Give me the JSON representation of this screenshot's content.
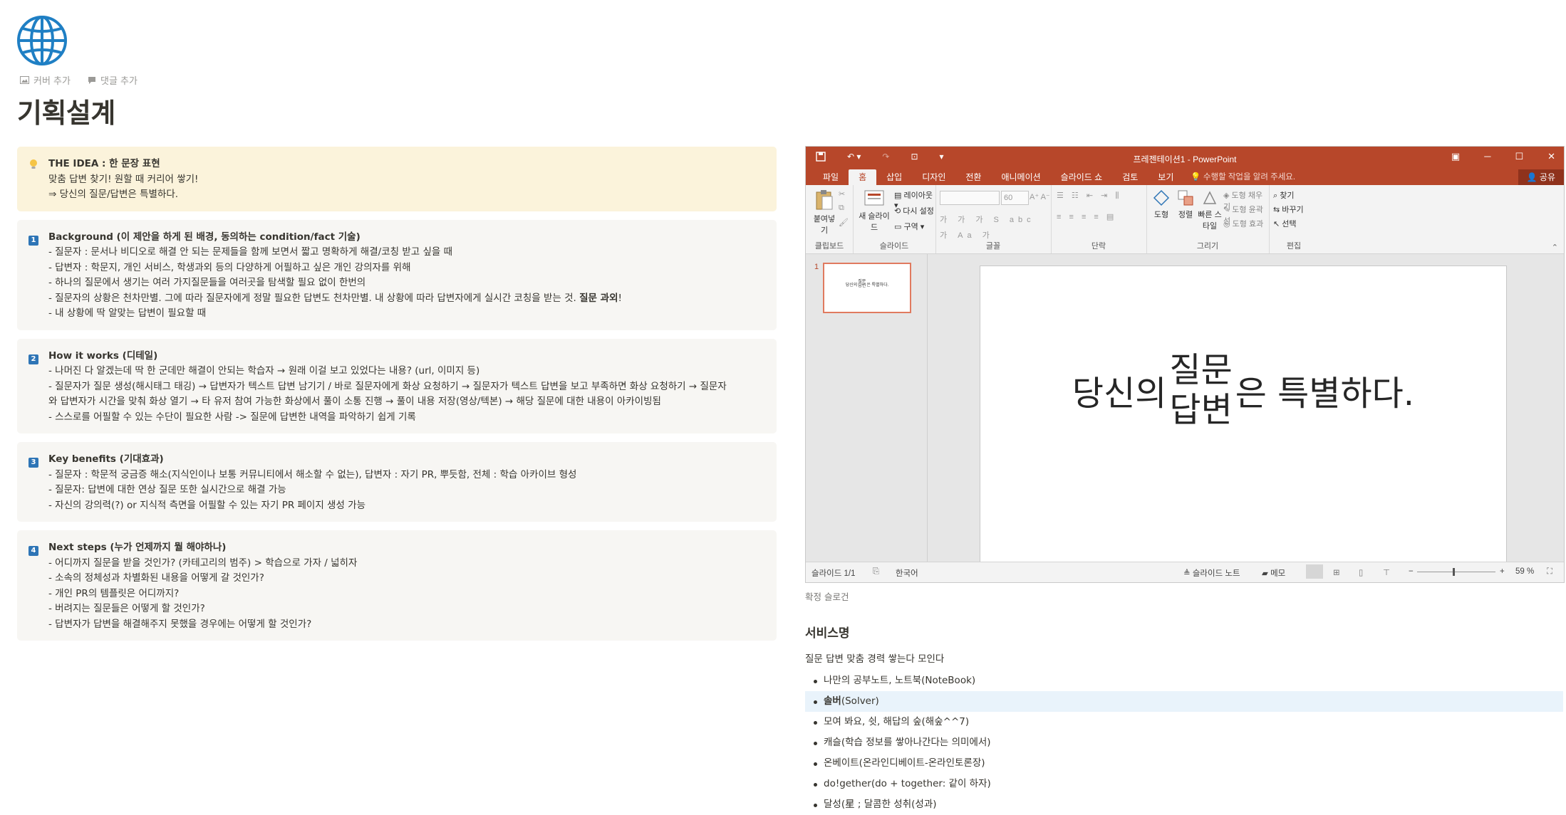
{
  "page": {
    "title": "기획설계",
    "actions": {
      "cover": "커버 추가",
      "comment": "댓글 추가"
    }
  },
  "callouts": {
    "idea": {
      "title": "THE IDEA : 한 문장 표현",
      "lines": [
        "맞춤 답변 찾기! 원할 때 커리어 쌓기!",
        "⇒ 당신의 질문/답변은 특별하다."
      ]
    },
    "background": {
      "num": "1",
      "title_a": "Background (",
      "title_b": "이 제안을 하게 된 배경, 동의하는 condition/fact 기술",
      "title_c": ")",
      "lines": [
        "- 질문자 : 문서나 비디오로 해결 안 되는 문제들을 함께 보면서 짧고 명확하게 해결/코칭  받고 싶을 때",
        "- 답변자 : 학문지, 개인 서비스, 학생과외 등의 다양하게 어필하고 싶은 개인 강의자를 위해",
        "- 하나의 질문에서 생기는 여러 가지질문들을 여러곳을 탐색할 필요 없이 한번의",
        "- 질문자의 상황은 천차만별. 그에 따라 질문자에게 정말 필요한 답변도 천차만별. 내 상황에 따라 답변자에게 실시간 코칭을 받는 것.",
        "- 내 상황에 딱 알맞는 답변이 필요할 때"
      ],
      "emph": "질문 과외",
      "emph_tail": "!"
    },
    "how": {
      "num": "2",
      "title_a": "How it works (",
      "title_b": "디테일",
      "title_c": ")",
      "lines": [
        "- 나머진 다 알겠는데 딱 한 군데만 해결이 안되는 학습자 → 원래 이걸 보고 있었다는 내용? (url, 이미지 등)",
        "- 질문자가 질문 생성(해시태그 태깅) → 답변자가 텍스트 답변 남기기 / 바로 질문자에게 화상 요청하기 → 질문자가 텍스트 답변을 보고 부족하면 화상 요청하기 → 질문자",
        "와 답변자가 시간을 맞춰 화상 열기 → 타 유저 참여 가능한 화상에서 풀이 소통 진행 → 풀이 내용 저장(영상/텍본) → 해당 질문에 대한 내용이 아카이빙됨",
        "- 스스로를 어필할 수 있는 수단이 필요한 사람 -> 질문에 답변한 내역을 파악하기 쉽게 기록"
      ]
    },
    "benefits": {
      "num": "3",
      "title_a": "Key benefits (",
      "title_b": "기대효과",
      "title_c": ")",
      "lines": [
        "- 질문자 : 학문적 궁금증 해소(지식인이나 보통 커뮤니티에서 해소할 수 없는), 답변자 : 자기 PR, 뿌듯함, 전체 : 학습 아카이브 형성",
        "- 질문자: 답변에 대한 연상 질문 또한 실시간으로 해결 가능",
        "- 자신의 강의력(?) or 지식적 측면을 어필할 수 있는 자기 PR 페이지 생성 가능"
      ]
    },
    "next": {
      "num": "4",
      "title_a": "Next steps (",
      "title_b": "누가 언제까지 뭘 해야하나",
      "title_c": ")",
      "lines": [
        "- 어디까지 질문을 받을 것인가? (카테고리의 범주) > 학습으로 가자 / 넓히자",
        "- 소속의 정체성과 차별화된 내용을 어떻게 갈 것인가?",
        "- 개인 PR의 템플릿은 어디까지?",
        "- 버려지는 질문들은 어떻게 할 것인가?",
        "- 답변자가 답변을 해결해주지 못했을 경우에는 어떻게 할 것인가?"
      ]
    }
  },
  "ppt": {
    "window_title": "프레젠테이션1 - PowerPoint",
    "tabs": [
      "파일",
      "홈",
      "삽입",
      "디자인",
      "전환",
      "애니메이션",
      "슬라이드 쇼",
      "검토",
      "보기"
    ],
    "tell_me": "수행할 작업을 알려 주세요.",
    "share": "공유",
    "ribbon": {
      "paste": "붙여넣기",
      "clipboard": "클립보드",
      "new_slide": "새 슬라이드",
      "layout": "레이아웃",
      "reset": "다시 설정",
      "section": "구역",
      "slides": "슬라이드",
      "font_size": "60",
      "font_group": "글꼴",
      "paragraph": "단락",
      "shape": "도형",
      "arrange": "정렬",
      "quick_styles": "빠른 스타일",
      "fill": "도형 채우기",
      "outline": "도형 윤곽선",
      "effects": "도형 효과",
      "drawing": "그리기",
      "find": "찾기",
      "replace": "바꾸기",
      "select": "선택",
      "editing": "편집"
    },
    "slide_num": "1",
    "thumb_text_a": "당신의",
    "thumb_text_b1": "질문",
    "thumb_text_b2": "답변",
    "thumb_text_c": "은 특별하다.",
    "slide": {
      "part_a": "당신의",
      "stack_top": "질문",
      "stack_bottom": "답변",
      "part_c": "은 특별하다."
    },
    "status": {
      "slide_info": "슬라이드 1/1",
      "language": "한국어",
      "notes": "슬라이드 노트",
      "comments": "메모",
      "zoom": "59 %"
    }
  },
  "caption": "확정 슬로건",
  "service": {
    "heading": "서비스명",
    "desc": "질문 답변 맞춤 경력 쌓는다 모인다",
    "items": [
      {
        "text": "나만의 공부노트, 노트북(NoteBook)"
      },
      {
        "bold": "솔버",
        "text": "(Solver)"
      },
      {
        "text": "모여 봐요, 쉿, 해답의 숲(해숲^^7)"
      },
      {
        "text": "캐슬(학습 정보를 쌓아나간다는 의미에서)"
      },
      {
        "text": " 온베이트(온라인디베이트-온라인토론장)"
      },
      {
        "text": " do!gether(do + together: 같이 하자)"
      },
      {
        "text": "달성(星 ; 달콤한 성취(성과)"
      }
    ]
  }
}
